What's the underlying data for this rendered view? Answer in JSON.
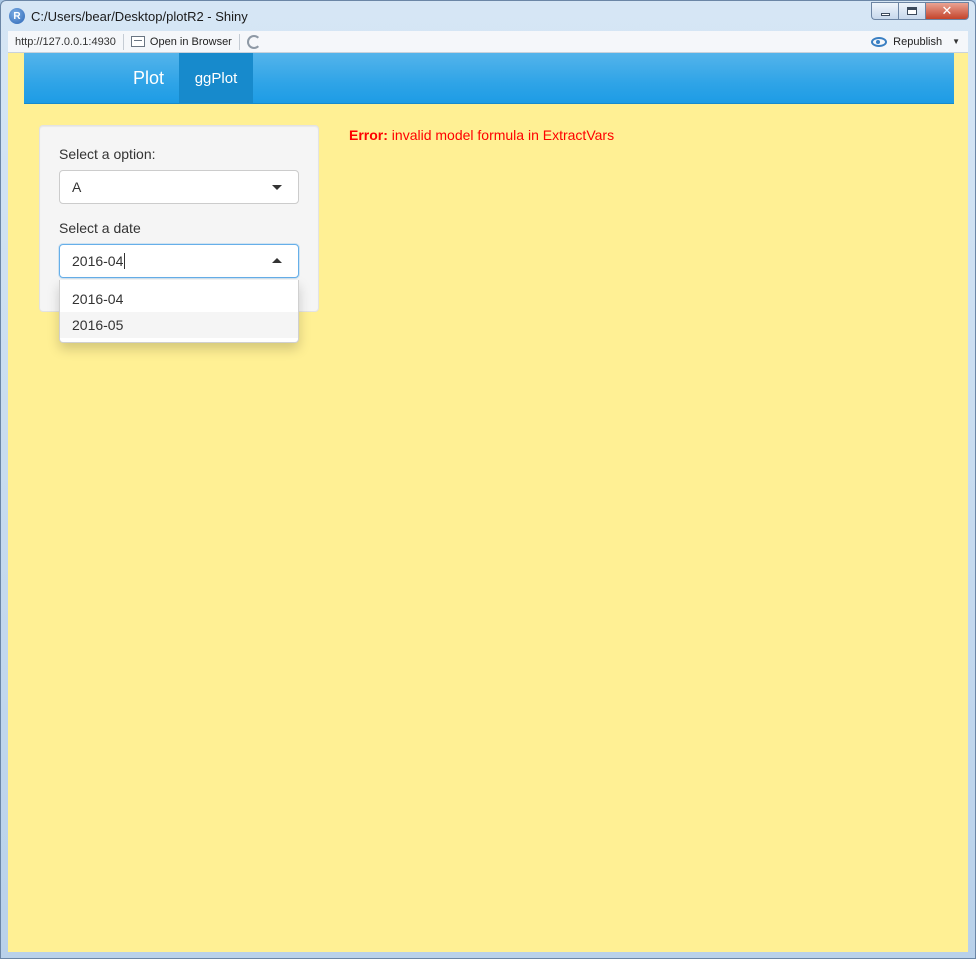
{
  "window": {
    "title": "C:/Users/bear/Desktop/plotR2 - Shiny",
    "app_icon_letter": "R"
  },
  "toolbar": {
    "url": "http://127.0.0.1:4930",
    "open_in_browser": "Open in Browser",
    "republish": "Republish"
  },
  "navbar": {
    "brand": "Plot",
    "tabs": [
      {
        "label": "ggPlot",
        "active": true
      }
    ]
  },
  "sidebar": {
    "option_label": "Select a option:",
    "option_value": "A",
    "date_label": "Select a date",
    "date_value": "2016-04"
  },
  "dropdown": {
    "items": [
      "2016-04",
      "2016-05"
    ],
    "highlighted": "2016-05"
  },
  "error": {
    "label": "Error:",
    "message": "invalid model formula in ExtractVars"
  },
  "colors": {
    "page_background": "#fff094",
    "navbar": "#2fa4e7",
    "error": "#ff0000"
  }
}
